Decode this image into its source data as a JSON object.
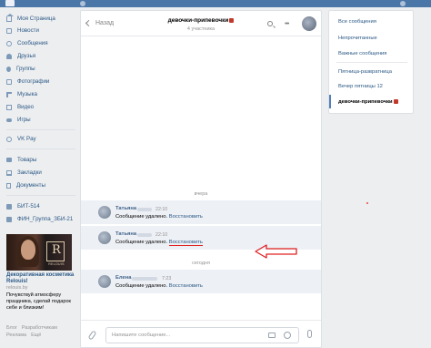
{
  "sidebar": {
    "items": [
      {
        "label": "Моя Страница",
        "icon": "home-icon"
      },
      {
        "label": "Новости",
        "icon": "news-icon"
      },
      {
        "label": "Сообщения",
        "icon": "messages-icon"
      },
      {
        "label": "Друзья",
        "icon": "friends-icon"
      },
      {
        "label": "Группы",
        "icon": "groups-icon"
      },
      {
        "label": "Фотографии",
        "icon": "photos-icon"
      },
      {
        "label": "Музыка",
        "icon": "music-icon"
      },
      {
        "label": "Видео",
        "icon": "video-icon"
      },
      {
        "label": "Игры",
        "icon": "games-icon"
      },
      {
        "label": "VK Pay",
        "icon": "vkpay-icon"
      },
      {
        "label": "Товары",
        "icon": "goods-icon"
      },
      {
        "label": "Закладки",
        "icon": "bookmarks-icon"
      },
      {
        "label": "Документы",
        "icon": "documents-icon"
      },
      {
        "label": "БИТ-514",
        "icon": "community-icon"
      },
      {
        "label": "ФИН_Группа_ЗБИ-21",
        "icon": "community-icon"
      }
    ],
    "ad": {
      "brand_letter": "R",
      "brand_name": "RELOUIS",
      "title": "Декоративная косметика Relouis!",
      "domain": "relouis.by",
      "text": "Почувствуй атмосферу праздника, сделай подарок себе и близким!"
    },
    "footer": [
      "Блог",
      "Разработчикам",
      "Реклама",
      "Ещё"
    ]
  },
  "chat": {
    "back_label": "Назад",
    "title": "девочки-припевочки",
    "subtitle": "4 участника",
    "date_yesterday": "вчера",
    "date_today": "сегодня",
    "messages": [
      {
        "author": "Татьяна",
        "time": "22:10",
        "text": "Сообщение удалено.",
        "restore": "Восстановить"
      },
      {
        "author": "Татьяна",
        "time": "22:10",
        "text": "Сообщение удалено.",
        "restore": "Восстановить"
      },
      {
        "author": "Елена",
        "time": "7:23",
        "text": "Сообщение удалено.",
        "restore": "Восстановить"
      }
    ],
    "composer_placeholder": "Напишите сообщение..."
  },
  "right_panel": {
    "items": [
      {
        "label": "Все сообщения"
      },
      {
        "label": "Непрочитанные"
      },
      {
        "label": "Важные сообщения"
      },
      {
        "label": "Пятница-развратница"
      },
      {
        "label": "Вечер пятницы 12"
      },
      {
        "label": "девочки-припевочки"
      }
    ]
  },
  "colors": {
    "header_bar": "#4a76a8",
    "link": "#2a5885",
    "arrow": "#e02020",
    "message_bg": "#edf0f5"
  }
}
